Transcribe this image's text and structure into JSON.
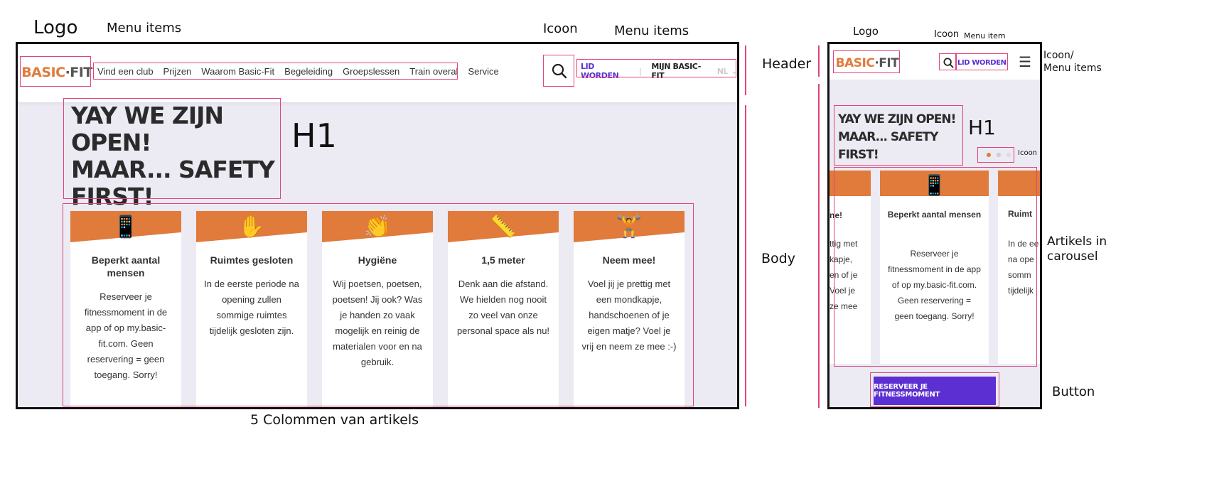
{
  "annotations": {
    "logo": "Logo",
    "menu_items_left": "Menu items",
    "icon": "Icoon",
    "menu_items_right": "Menu items",
    "header": "Header",
    "h1": "H1",
    "body": "Body",
    "five_columns": "5 Colommen van artikels",
    "mobile_logo": "Logo",
    "mobile_icon": "Icoon",
    "mobile_menu_item": "Menu item",
    "mobile_icon_menu_line1": "Icoon/",
    "mobile_icon_menu_line2": "Menu items",
    "mobile_h1": "H1",
    "mobile_dots_icon": "Icoon",
    "carousel_line1": "Artikels in",
    "carousel_line2": "carousel",
    "button": "Button"
  },
  "brand": {
    "logo_part1": "BASIC",
    "logo_part2": "·FIT",
    "accent_orange": "#e07b3c",
    "accent_purple": "#5b2fd1"
  },
  "nav": {
    "items": [
      "Vind een club",
      "Prijzen",
      "Waarom Basic-Fit",
      "Begeleiding",
      "Groepslessen",
      "Train overal",
      "Service"
    ],
    "search_icon": "search-icon",
    "lid_worden": "LID WORDEN",
    "separator": "|",
    "mijn_basic_fit": "MIJN BASIC-FIT",
    "language": "NL",
    "chevron": "⌄"
  },
  "hero": {
    "line1": "YAY WE ZIJN OPEN!",
    "line2": "MAAR... SAFETY",
    "line3": "FIRST!"
  },
  "cards": [
    {
      "icon": "📱",
      "icon_name": "phone-icon",
      "title": "Beperkt aantal mensen",
      "text": "Reserveer je fitnessmoment in de app of op my.basic-fit.com. Geen reservering = geen toegang. Sorry!"
    },
    {
      "icon": "✋",
      "icon_name": "raised-hand-icon",
      "title": "Ruimtes gesloten",
      "text": "In de eerste periode na opening zullen sommige ruimtes tijdelijk gesloten zijn."
    },
    {
      "icon": "👏",
      "icon_name": "clapping-hands-icon",
      "title": "Hygiëne",
      "text": "Wij poetsen, poetsen, poetsen! Jij ook? Was je handen zo vaak mogelijk en reinig de materialen voor en na gebruik."
    },
    {
      "icon": "📏",
      "icon_name": "ruler-icon",
      "title": "1,5 meter",
      "text": "Denk aan die afstand. We hielden nog nooit zo veel van onze personal space als nu!"
    },
    {
      "icon": "🏋",
      "icon_name": "weightlifter-icon",
      "title": "Neem mee!",
      "text": "Voel jij je prettig met een mondkapje, handschoenen of je eigen matje? Voel je vrij en neem ze mee :-)"
    }
  ],
  "mobile": {
    "lid_worden": "LID WORDEN",
    "hamburger_icon": "☰",
    "h1_line1": "YAY WE ZIJN OPEN!",
    "h1_line2": "MAAR... SAFETY",
    "h1_line3": "FIRST!",
    "left_card_title_fragment": "ne!",
    "left_card_text": [
      "ttig met",
      "kapje,",
      "en of je",
      "Voel je",
      "ze mee"
    ],
    "center_card_title": "Beperkt aantal mensen",
    "center_card_text": "Reserveer je fitnessmoment in de app of op my.basic-fit.com. Geen reservering = geen toegang. Sorry!",
    "right_card_title_fragment": "Ruimt",
    "right_card_text": [
      "In de ee",
      "na ope",
      "somm",
      "tijdelijk"
    ],
    "cta": "RESERVEER JE FITNESSMOMENT"
  }
}
